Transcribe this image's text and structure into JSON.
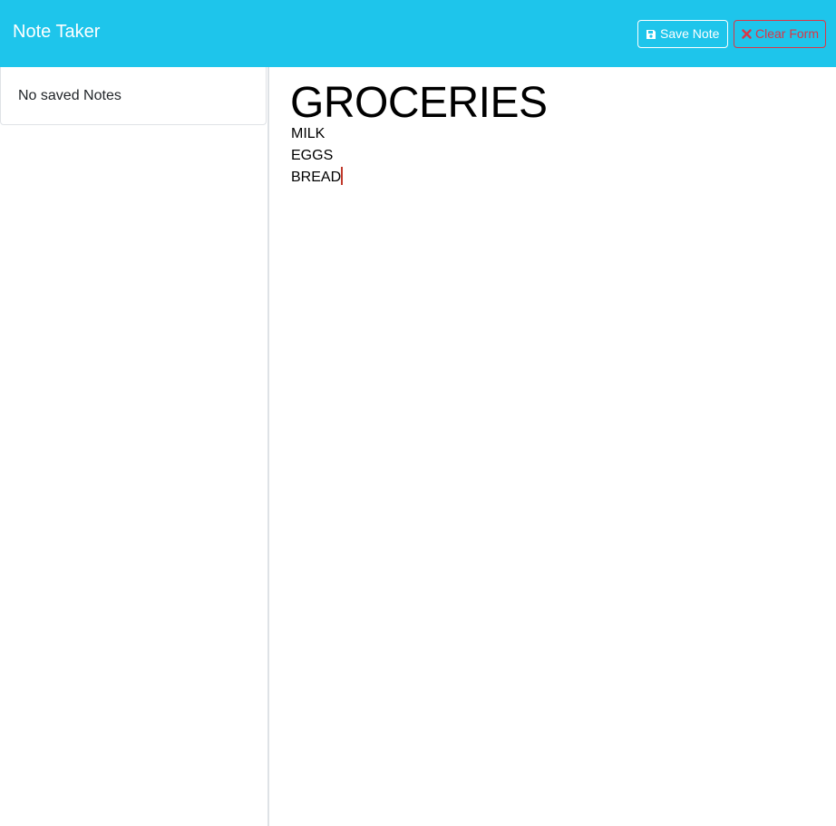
{
  "app": {
    "title": "Note Taker"
  },
  "toolbar": {
    "save_label": "Save Note",
    "save_icon": "floppy-disk-icon",
    "clear_label": "Clear Form",
    "clear_icon": "x-icon"
  },
  "sidebar": {
    "empty_message": "No saved Notes"
  },
  "note": {
    "title": "GROCERIES",
    "lines": [
      "MILK",
      "EGGS",
      "BREAD"
    ]
  },
  "colors": {
    "navbar": "#1ec5eb",
    "save_button": "#ffffff",
    "clear_button": "#dc3545",
    "caret": "#c0392b"
  }
}
